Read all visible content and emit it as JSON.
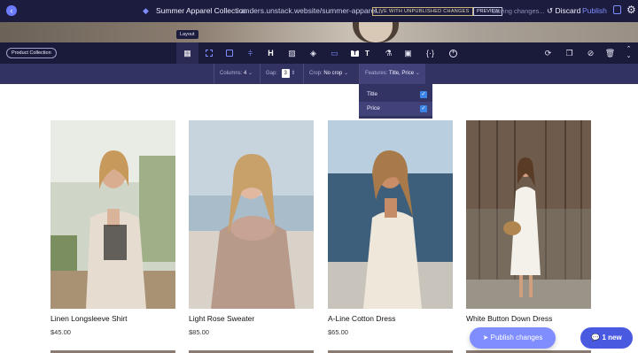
{
  "topbar": {
    "back_icon": "chevron-left-icon",
    "site_title": "Summer Apparel Collection",
    "url": "anders.unstack.website/summer-apparel...",
    "live_badge": "LIVE WITH UNPUBLISHED CHANGES",
    "preview": "PREVIEW",
    "saving": "Saving changes...",
    "discard": "Discard",
    "publish": "Publish",
    "accent": "#7f8dff"
  },
  "tooltip": "Layout",
  "toolbar": {
    "section_label": "Product Collection",
    "tools": [
      "layout-icon",
      "grid-icon",
      "section-icon",
      "columns-icon",
      "heading-icon",
      "image-icon",
      "fill-icon",
      "width-icon",
      "text-icon",
      "font-icon",
      "flask-icon",
      "frame-icon",
      "code-icon",
      "add-icon"
    ],
    "right_tools": [
      "refresh-icon",
      "duplicate-icon",
      "hide-icon",
      "delete-icon",
      "reorder-icon"
    ]
  },
  "subbar": {
    "columns_label": "Columns:",
    "columns_value": "4",
    "gap_label": "Gap:",
    "gap_value": "3",
    "crop_label": "Crop:",
    "crop_value": "No crop",
    "features_label": "Features:",
    "features_value": "Title, Price"
  },
  "dropdown": {
    "items": [
      {
        "label": "Title",
        "checked": true
      },
      {
        "label": "Price",
        "checked": true
      }
    ]
  },
  "products": [
    {
      "name": "Linen Longsleeve Shirt",
      "price": "$45.00"
    },
    {
      "name": "Light Rose Sweater",
      "price": "$85.00"
    },
    {
      "name": "A-Line Cotton Dress",
      "price": "$65.00"
    },
    {
      "name": "White Button Down Dress",
      "price": ""
    }
  ],
  "publish_changes": "Publish changes",
  "chat": "1 new"
}
